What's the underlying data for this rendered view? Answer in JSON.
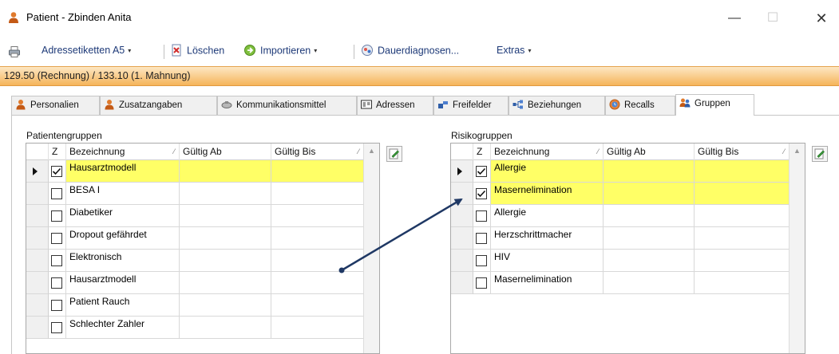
{
  "window": {
    "title": "Patient - Zbinden Anita",
    "minimize": "—",
    "maximize": "☐",
    "close": "✕"
  },
  "toolbar": {
    "address_labels": "Adressetiketten A5",
    "delete": "Löschen",
    "import": "Importieren",
    "permanent_diagnoses": "Dauerdiagnosen...",
    "extras": "Extras",
    "dropdown_glyph": "▾"
  },
  "status": {
    "balance": "129.50 (Rechnung) / 133.10 (1. Mahnung)"
  },
  "tabs": [
    {
      "label": "Personalien",
      "icon": "person-icon"
    },
    {
      "label": "Zusatzangaben",
      "icon": "person-icon"
    },
    {
      "label": "Kommunikationsmittel",
      "icon": "phone-icon"
    },
    {
      "label": "Adressen",
      "icon": "address-card-icon"
    },
    {
      "label": "Freifelder",
      "icon": "fields-icon"
    },
    {
      "label": "Beziehungen",
      "icon": "relations-icon"
    },
    {
      "label": "Recalls",
      "icon": "recall-icon"
    },
    {
      "label": "Gruppen",
      "icon": "groups-icon",
      "active": true
    }
  ],
  "patient_groups": {
    "label": "Patientengruppen",
    "columns": {
      "z": "Z",
      "name": "Bezeichnung",
      "from": "Gültig Ab",
      "to": "Gültig Bis"
    },
    "sort_glyph": "⁄",
    "rows": [
      {
        "checked": true,
        "name": "Hausarztmodell",
        "highlight": true,
        "current": true
      },
      {
        "checked": false,
        "name": "BESA I"
      },
      {
        "checked": false,
        "name": "Diabetiker"
      },
      {
        "checked": false,
        "name": "Dropout gefährdet"
      },
      {
        "checked": false,
        "name": "Elektronisch"
      },
      {
        "checked": false,
        "name": "Hausarztmodell"
      },
      {
        "checked": false,
        "name": "Patient Rauch"
      },
      {
        "checked": false,
        "name": "Schlechter Zahler"
      }
    ]
  },
  "risk_groups": {
    "label": "Risikogruppen",
    "columns": {
      "z": "Z",
      "name": "Bezeichnung",
      "from": "Gültig Ab",
      "to": "Gültig Bis"
    },
    "sort_glyph": "⁄",
    "rows": [
      {
        "checked": true,
        "name": "Allergie",
        "highlight": true,
        "current": true
      },
      {
        "checked": true,
        "name": "Masernelimination",
        "highlight": true
      },
      {
        "checked": false,
        "name": "Allergie"
      },
      {
        "checked": false,
        "name": "Herzschrittmacher"
      },
      {
        "checked": false,
        "name": "HIV"
      },
      {
        "checked": false,
        "name": "Masernelimination"
      }
    ]
  },
  "colors": {
    "highlight": "#ffff66",
    "status_bar": "#f5b45a",
    "annotation_arrow": "#1f3864",
    "toolbar_text": "#1e3a78"
  }
}
